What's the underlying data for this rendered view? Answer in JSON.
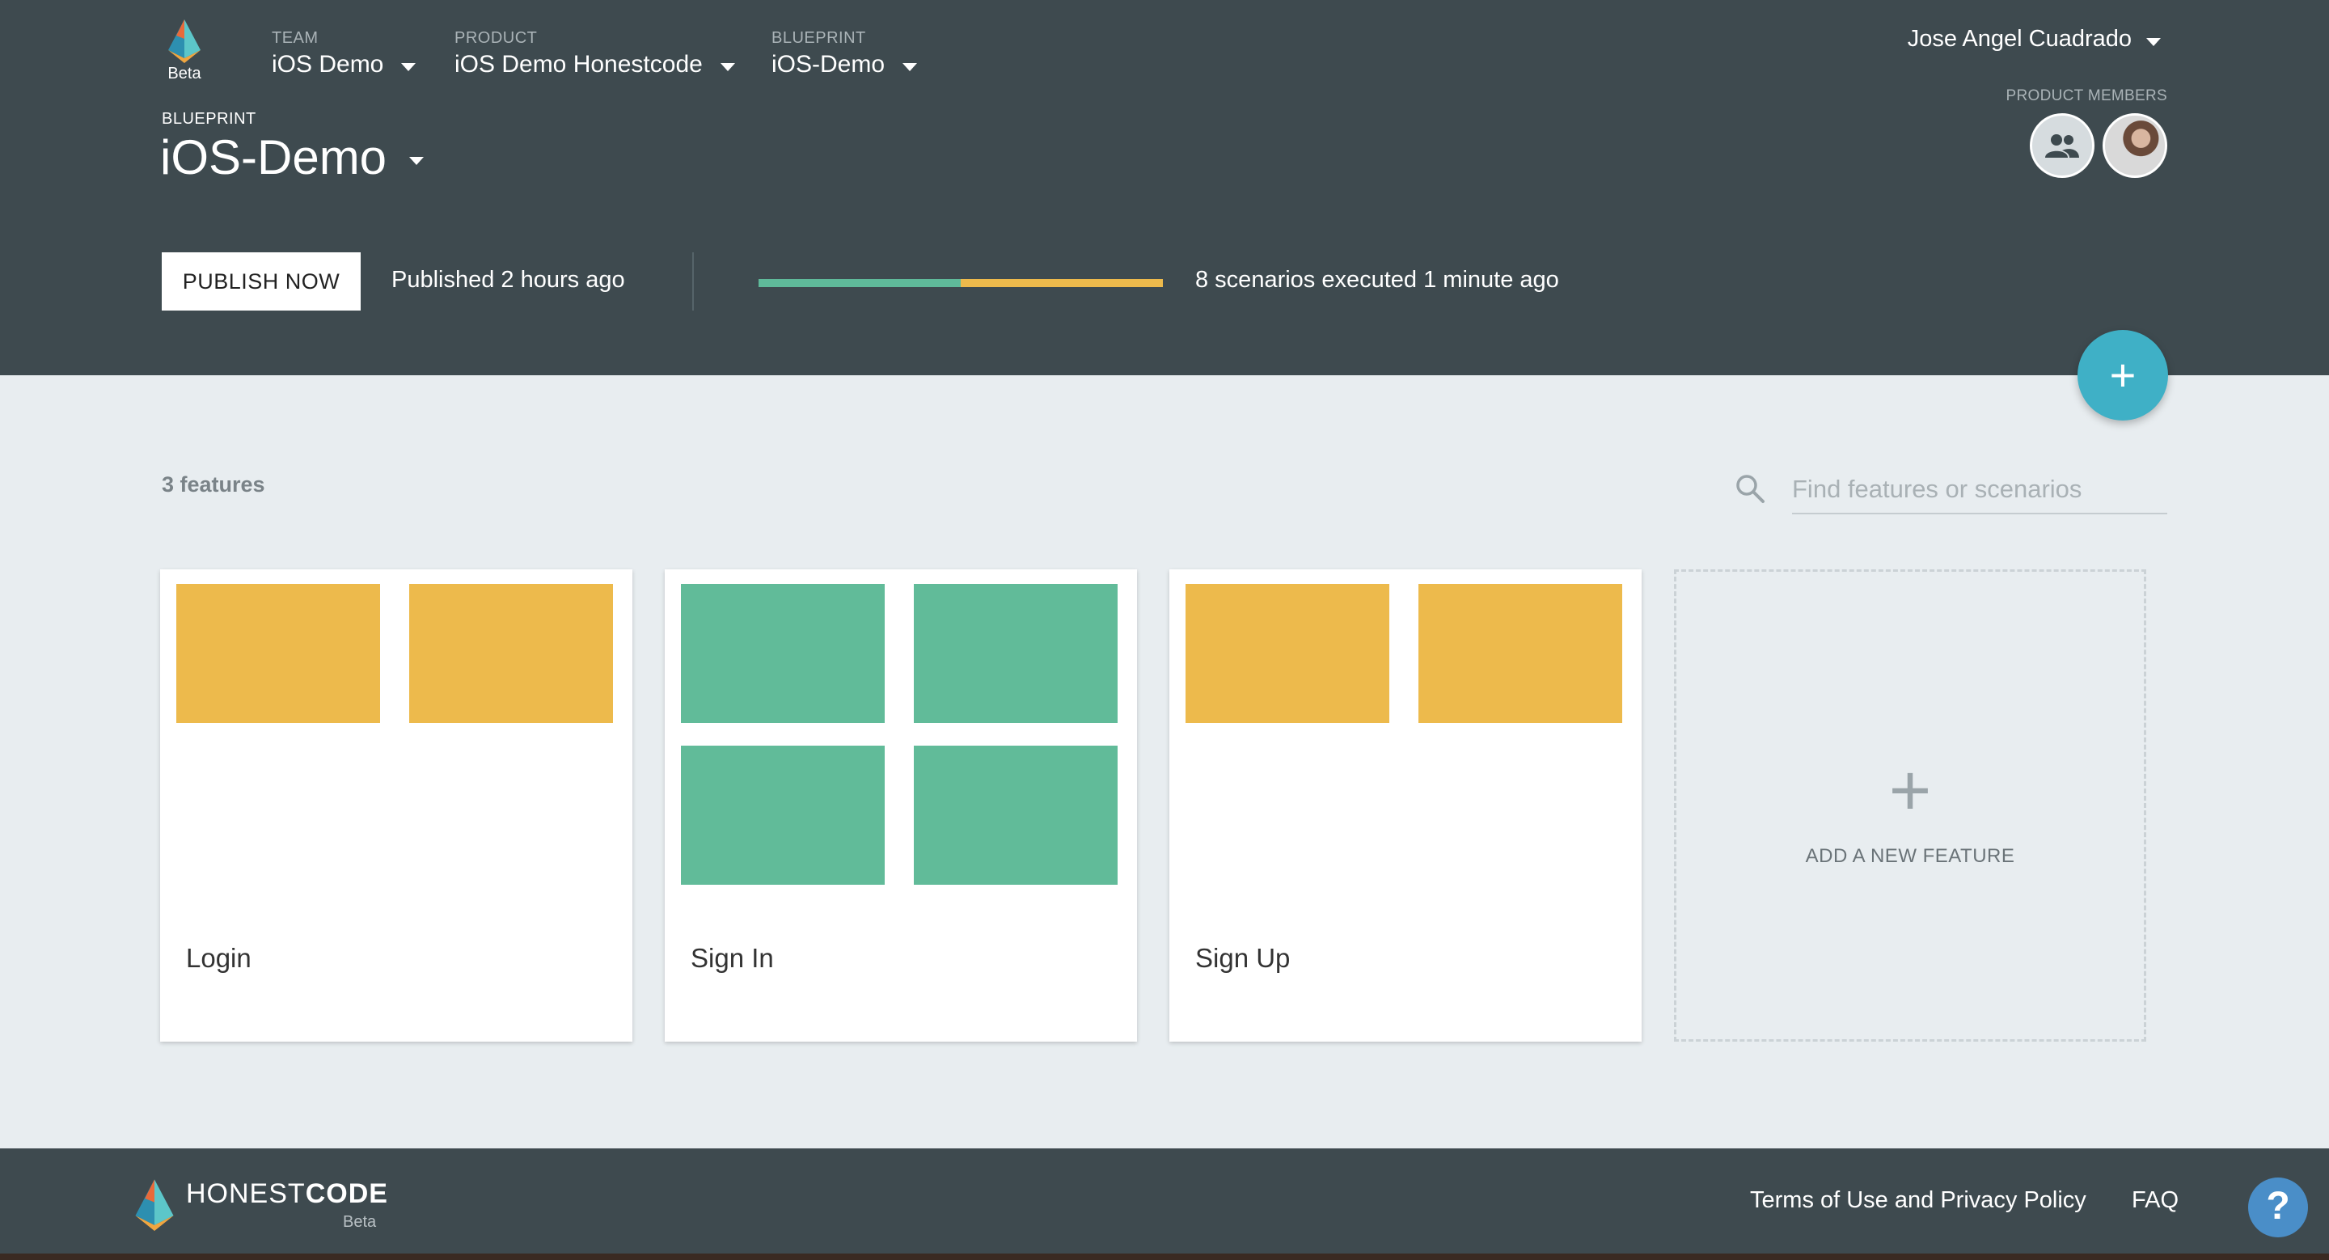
{
  "colors": {
    "header_bg": "#3e4a4f",
    "page_bg": "#e8edf0",
    "accent": "#3fb0c6",
    "pass": "#61bb99",
    "pending": "#edba4c"
  },
  "header": {
    "logo_beta": "Beta",
    "team": {
      "label": "TEAM",
      "value": "iOS Demo"
    },
    "product": {
      "label": "PRODUCT",
      "value": "iOS Demo Honestcode"
    },
    "blueprint_nav": {
      "label": "BLUEPRINT",
      "value": "iOS-Demo"
    },
    "user_name": "Jose Angel Cuadrado",
    "blueprint_label": "BLUEPRINT",
    "blueprint_title": "iOS-Demo",
    "members_label": "PRODUCT MEMBERS",
    "publish_button": "PUBLISH NOW",
    "published_status": "Published 2 hours ago",
    "progress": {
      "passed_fraction": 0.5,
      "pending_fraction": 0.5
    },
    "scenarios_status": "8 scenarios executed 1 minute ago",
    "add_icon": "plus-icon"
  },
  "main": {
    "feature_count": "3 features",
    "search_placeholder": "Find features or scenarios",
    "features": [
      {
        "title": "Login",
        "tiles": [
          "pending",
          "pending"
        ]
      },
      {
        "title": "Sign In",
        "tiles": [
          "pass",
          "pass",
          "pass",
          "pass"
        ]
      },
      {
        "title": "Sign Up",
        "tiles": [
          "pending",
          "pending"
        ]
      }
    ],
    "add_feature_label": "ADD A NEW FEATURE"
  },
  "footer": {
    "brand_light": "HONEST",
    "brand_bold": "CODE",
    "beta": "Beta",
    "terms_link": "Terms of Use and Privacy Policy",
    "faq_link": "FAQ",
    "help_label": "?"
  }
}
